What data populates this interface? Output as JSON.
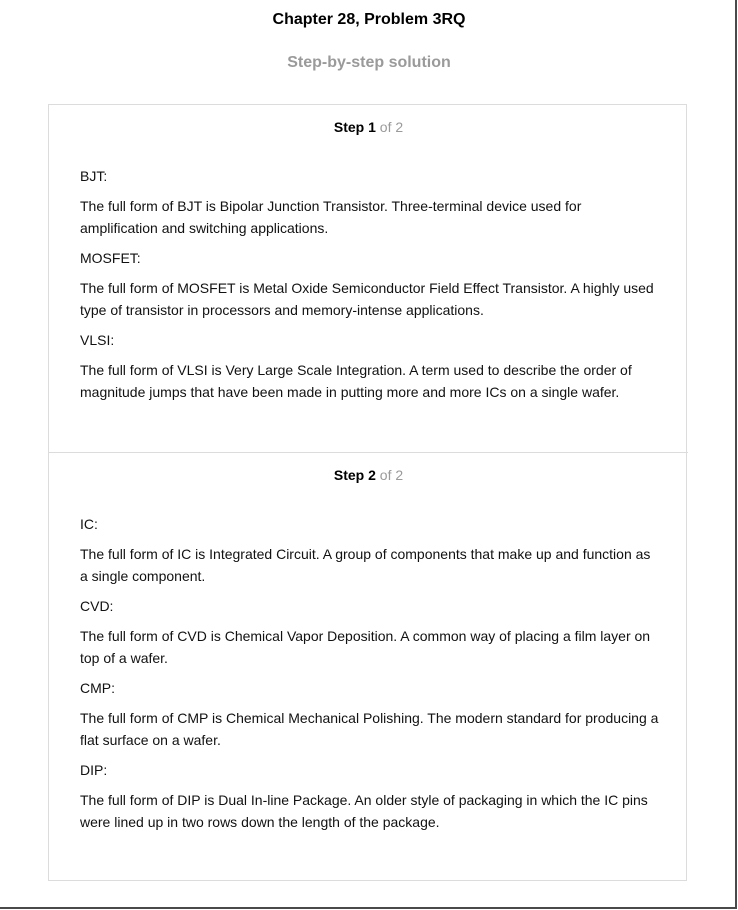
{
  "header": {
    "title": "Chapter 28, Problem 3RQ",
    "subtitle": "Step-by-step solution"
  },
  "steps": [
    {
      "label": "Step",
      "number": "1",
      "total": "of 2",
      "entries": [
        {
          "term": "BJT:",
          "description": "The full form of BJT is Bipolar Junction Transistor. Three-terminal device used for amplification and switching applications."
        },
        {
          "term": "MOSFET:",
          "description": "The full form of MOSFET is Metal Oxide Semiconductor Field Effect Transistor. A highly used type of transistor in processors and memory-intense applications."
        },
        {
          "term": "VLSI:",
          "description": "The full form of VLSI is Very Large Scale Integration. A term used to describe the order of magnitude jumps that have been made in putting more and more ICs on a single wafer."
        }
      ]
    },
    {
      "label": "Step",
      "number": "2",
      "total": "of 2",
      "entries": [
        {
          "term": "IC:",
          "description": "The full form of IC is Integrated Circuit. A group of components that make up and function as a single component."
        },
        {
          "term": "CVD:",
          "description": "The full form of CVD is Chemical Vapor Deposition. A common way of placing a film layer on top of a wafer."
        },
        {
          "term": "CMP:",
          "description": "The full form of CMP is Chemical Mechanical Polishing. The modern standard for producing a flat surface on a wafer."
        },
        {
          "term": "DIP:",
          "description": "The full form of DIP is Dual In-line Package. An older style of packaging in which the IC pins were lined up in two rows down the length of the package."
        }
      ]
    }
  ]
}
